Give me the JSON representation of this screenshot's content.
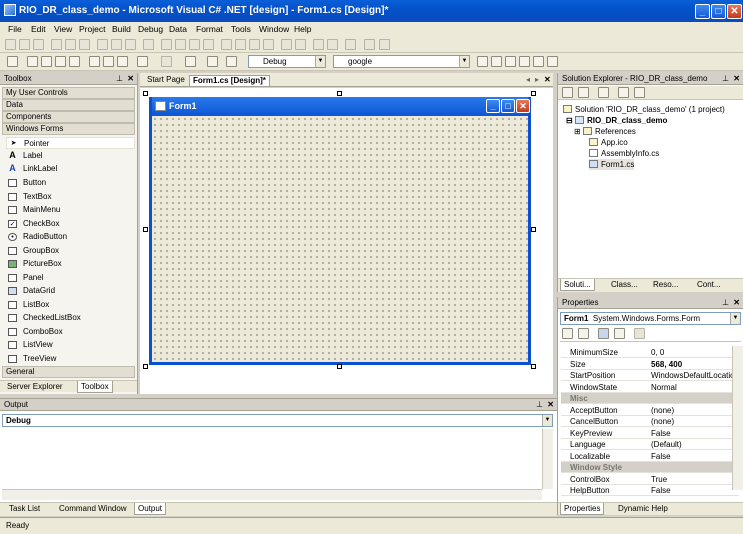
{
  "window": {
    "title": "RIO_DR_class_demo - Microsoft Visual C# .NET [design] - Form1.cs [Design]*",
    "min_label": "_",
    "max_label": "□",
    "close_label": "✕"
  },
  "menu": [
    "File",
    "Edit",
    "View",
    "Project",
    "Build",
    "Debug",
    "Data",
    "Format",
    "Tools",
    "Window",
    "Help"
  ],
  "toolbar": {
    "config_value": "Debug",
    "search_value": "google"
  },
  "toolbox": {
    "title": "Toolbox",
    "categories": [
      "My User Controls",
      "Data",
      "Components",
      "Windows Forms"
    ],
    "items": [
      "Pointer",
      "Label",
      "LinkLabel",
      "Button",
      "TextBox",
      "MainMenu",
      "CheckBox",
      "RadioButton",
      "GroupBox",
      "PictureBox",
      "Panel",
      "DataGrid",
      "ListBox",
      "CheckedListBox",
      "ComboBox",
      "ListView",
      "TreeView"
    ],
    "general": "General",
    "tabs": [
      "Server Explorer",
      "Toolbox"
    ]
  },
  "doc": {
    "tabs": [
      "Start Page",
      "Form1.cs [Design]*"
    ],
    "form_title": "Form1"
  },
  "solution_explorer": {
    "title": "Solution Explorer - RIO_DR_class_demo",
    "tree": [
      "Solution 'RIO_DR_class_demo' (1 project)",
      "RIO_DR_class_demo",
      "References",
      "App.ico",
      "AssemblyInfo.cs",
      "Form1.cs"
    ],
    "tabs": [
      "Soluti...",
      "Class...",
      "Reso...",
      "Cont..."
    ]
  },
  "properties": {
    "title": "Properties",
    "object_name": "Form1",
    "object_type": "System.Windows.Forms.Form",
    "rows": [
      {
        "name": "MinimumSize",
        "value": "0, 0",
        "cat": false
      },
      {
        "name": "Size",
        "value": "568, 400",
        "cat": false
      },
      {
        "name": "StartPosition",
        "value": "WindowsDefaultLocation",
        "cat": false
      },
      {
        "name": "WindowState",
        "value": "Normal",
        "cat": false
      },
      {
        "name": "Misc",
        "value": "",
        "cat": true
      },
      {
        "name": "AcceptButton",
        "value": "(none)",
        "cat": false
      },
      {
        "name": "CancelButton",
        "value": "(none)",
        "cat": false
      },
      {
        "name": "KeyPreview",
        "value": "False",
        "cat": false
      },
      {
        "name": "Language",
        "value": "(Default)",
        "cat": false
      },
      {
        "name": "Localizable",
        "value": "False",
        "cat": false
      },
      {
        "name": "Window Style",
        "value": "",
        "cat": true
      },
      {
        "name": "ControlBox",
        "value": "True",
        "cat": false
      },
      {
        "name": "HelpButton",
        "value": "False",
        "cat": false
      }
    ],
    "tabs": [
      "Properties",
      "Dynamic Help"
    ]
  },
  "output": {
    "title": "Output",
    "pane_value": "Debug",
    "tabs": [
      "Task List",
      "Command Window",
      "Output"
    ]
  },
  "status": "Ready"
}
